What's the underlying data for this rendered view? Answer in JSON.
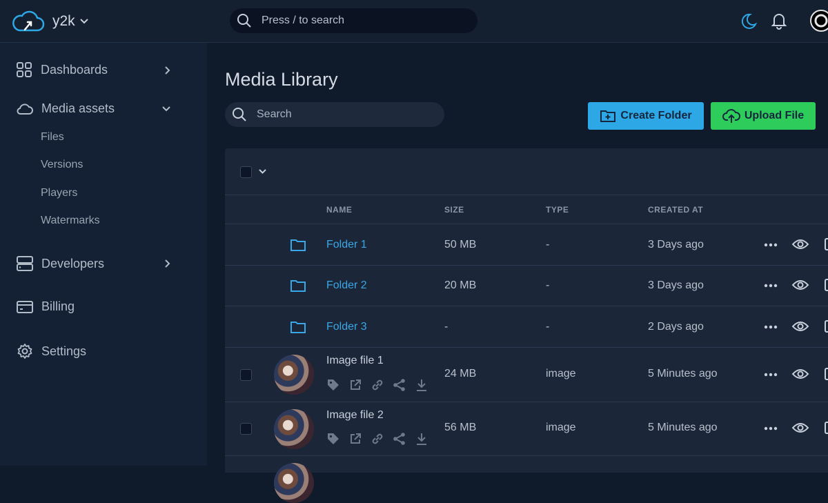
{
  "header": {
    "org_name": "y2k",
    "search_placeholder": "Press / to search"
  },
  "sidebar": {
    "items": [
      {
        "label": "Dashboards",
        "icon": "grid-icon"
      },
      {
        "label": "Media assets",
        "icon": "cloud-icon"
      },
      {
        "label": "Developers",
        "icon": "server-icon"
      },
      {
        "label": "Billing",
        "icon": "card-icon"
      },
      {
        "label": "Settings",
        "icon": "gear-icon"
      }
    ],
    "media_sub": [
      "Files",
      "Versions",
      "Players",
      "Watermarks"
    ]
  },
  "main": {
    "title": "Media Library",
    "search_placeholder": "Search",
    "create_folder_label": "Create Folder",
    "upload_file_label": "Upload File"
  },
  "table": {
    "columns": [
      "NAME",
      "SIZE",
      "TYPE",
      "CREATED AT"
    ],
    "rows": [
      {
        "kind": "folder",
        "name": "Folder 1",
        "size": "50 MB",
        "type": "-",
        "created": "3 Days ago"
      },
      {
        "kind": "folder",
        "name": "Folder 2",
        "size": "20 MB",
        "type": "-",
        "created": "3 Days ago"
      },
      {
        "kind": "folder",
        "name": "Folder 3",
        "size": "-",
        "type": "-",
        "created": "2 Days ago"
      },
      {
        "kind": "file",
        "name": "Image file 1",
        "size": "24 MB",
        "type": "image",
        "created": "5 Minutes ago"
      },
      {
        "kind": "file",
        "name": "Image file 2",
        "size": "56 MB",
        "type": "image",
        "created": "5 Minutes ago"
      }
    ]
  },
  "colors": {
    "accent_blue": "#2ea7e6",
    "accent_green": "#2ecc5a",
    "link": "#3aa7e6"
  }
}
